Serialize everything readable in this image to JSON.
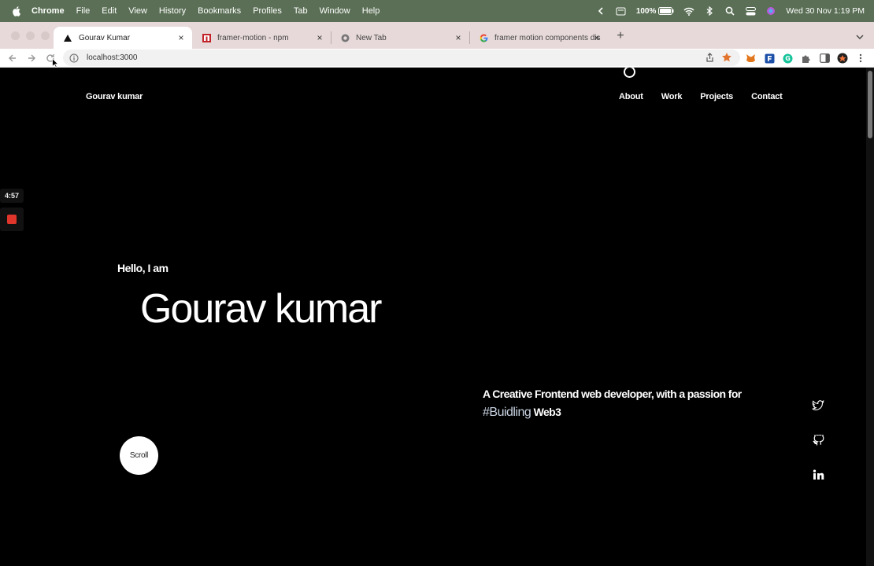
{
  "menubar": {
    "app_name": "Chrome",
    "items": [
      "File",
      "Edit",
      "View",
      "History",
      "Bookmarks",
      "Profiles",
      "Tab",
      "Window",
      "Help"
    ],
    "battery": "100%",
    "datetime": "Wed 30 Nov  1:19 PM"
  },
  "tabs": [
    {
      "title": "Gourav Kumar",
      "active": true,
      "icon": "vercel-triangle-icon"
    },
    {
      "title": "framer-motion - npm",
      "active": false,
      "icon": "npm-icon"
    },
    {
      "title": "New Tab",
      "active": false,
      "icon": "chrome-icon"
    },
    {
      "title": "framer motion components dis",
      "active": false,
      "icon": "google-icon"
    }
  ],
  "toolbar": {
    "url": "localhost:3000"
  },
  "page": {
    "brand": "Gourav kumar",
    "nav": [
      "About",
      "Work",
      "Projects",
      "Contact"
    ],
    "hello": "Hello, I am",
    "name": "Gourav kumar",
    "tagline_main": "A Creative Frontend web developer, with a passion for",
    "tagline_highlight": "#Buidling",
    "tagline_end": "Web3",
    "scroll_label": "Scroll",
    "social": [
      "twitter-icon",
      "github-icon",
      "linkedin-icon"
    ]
  },
  "recorder": {
    "time": "4:57"
  }
}
